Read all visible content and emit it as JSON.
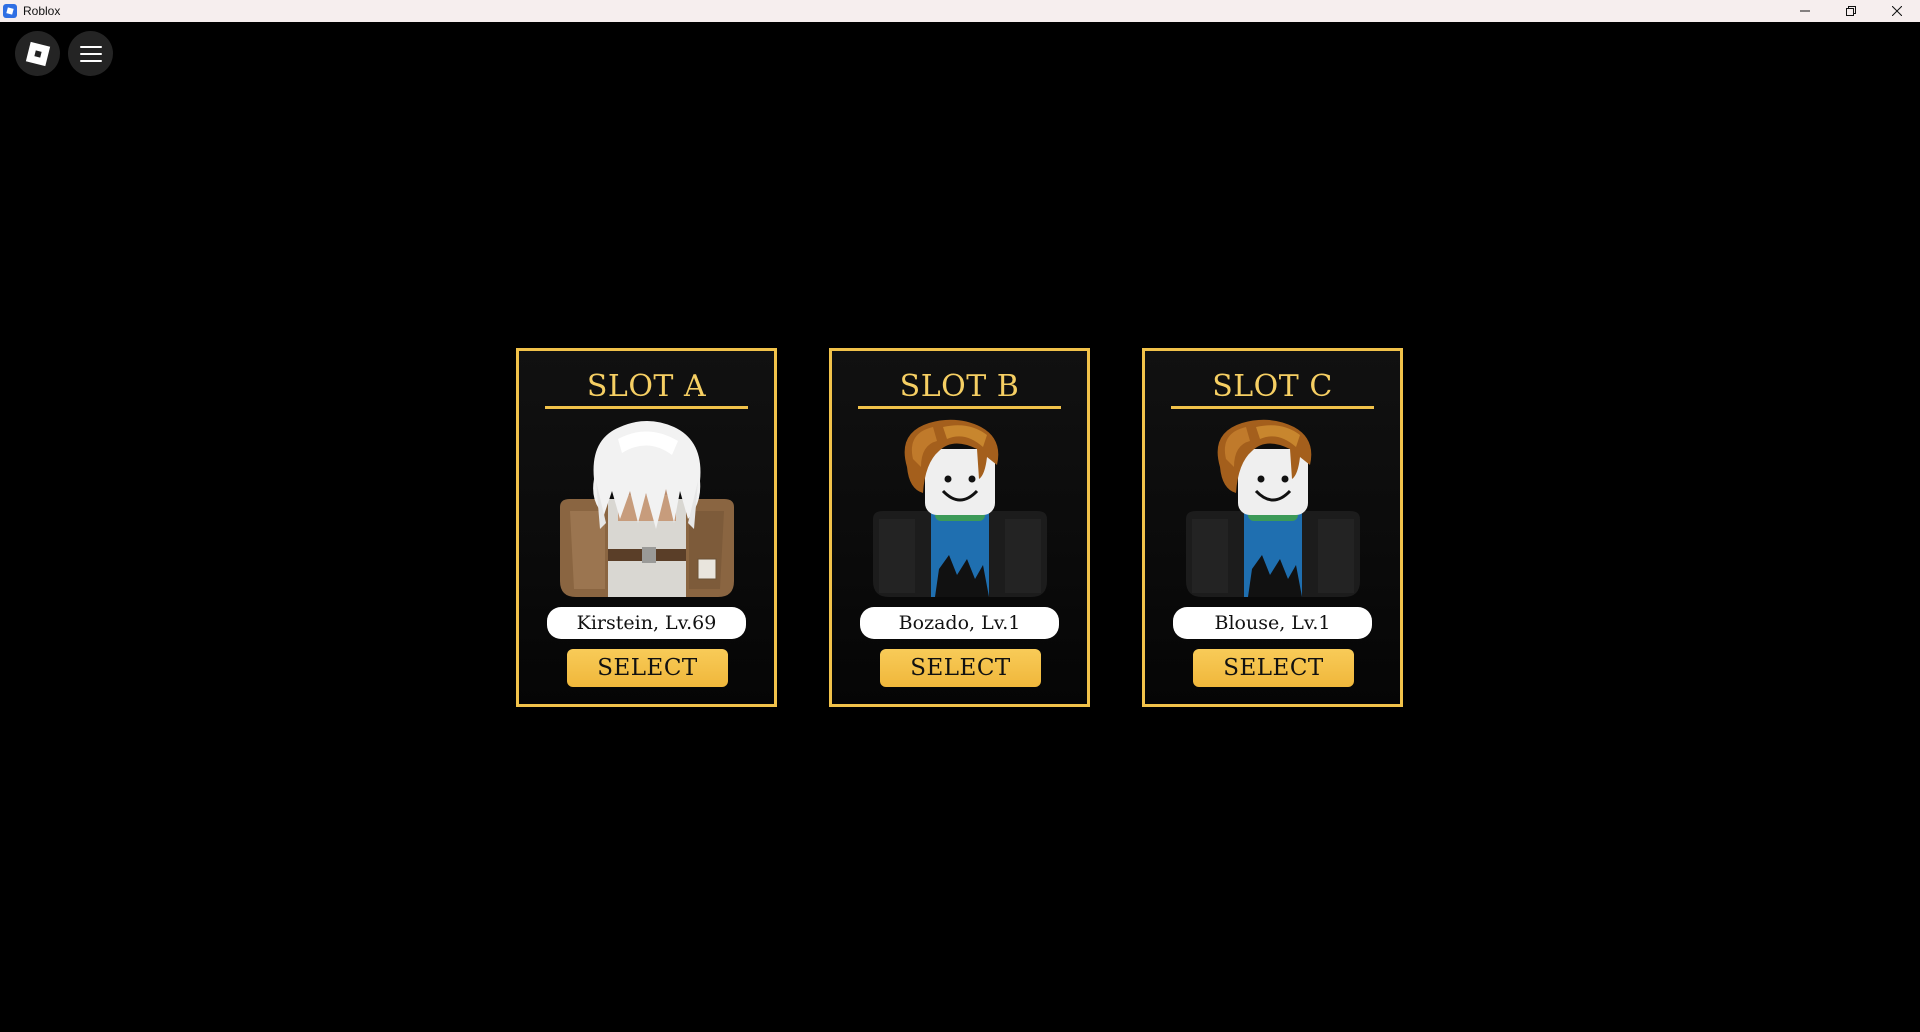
{
  "window": {
    "title": "Roblox",
    "controls": [
      "minimize-icon",
      "restore-icon",
      "close-icon"
    ]
  },
  "overlay": {
    "logo_icon": "roblox-logo-icon",
    "menu_icon": "hamburger-menu-icon"
  },
  "colors": {
    "accent_gold": "#f1c24a",
    "title_gold": "#f6cf63",
    "background": "#000000"
  },
  "slots": [
    {
      "title": "SLOT A",
      "character": "Kirstein, Lv.69",
      "avatar": "white-hair-brown-jacket-avatar",
      "select_label": "SELECT"
    },
    {
      "title": "SLOT B",
      "character": "Bozado, Lv.1",
      "avatar": "bacon-hair-avatar",
      "select_label": "SELECT"
    },
    {
      "title": "SLOT C",
      "character": "Blouse, Lv.1",
      "avatar": "bacon-hair-avatar",
      "select_label": "SELECT"
    }
  ]
}
